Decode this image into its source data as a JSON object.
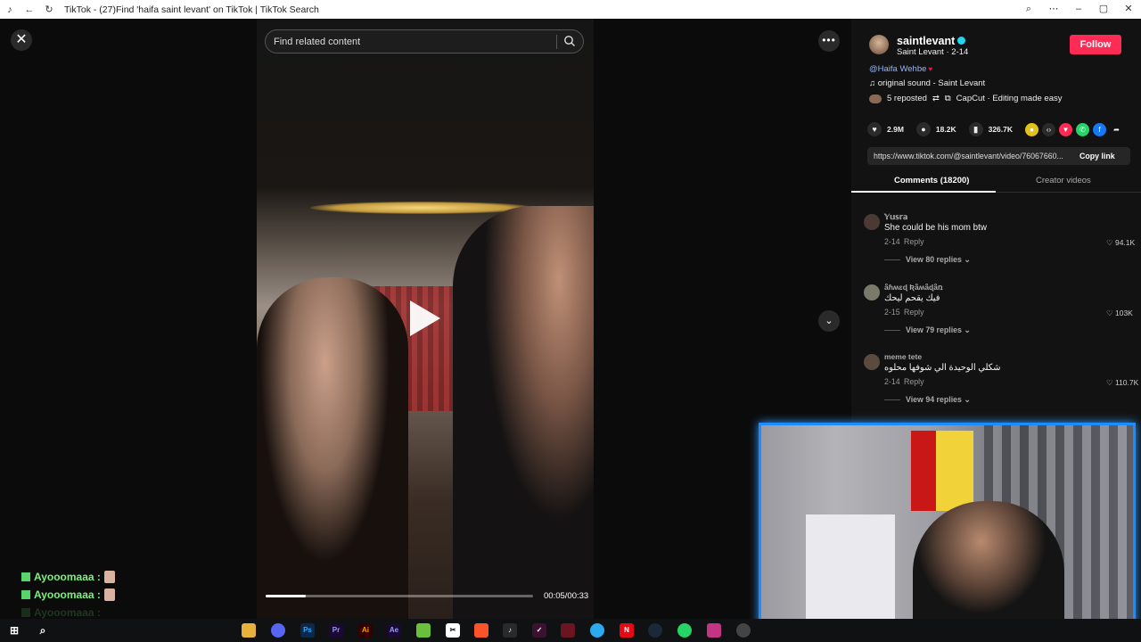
{
  "browser": {
    "title": "TikTok - (27)Find 'haifa saint levant' on TikTok | TikTok Search"
  },
  "search": {
    "placeholder": "Find related content"
  },
  "video": {
    "time": "00:05/00:33",
    "progress_fraction": 0.15
  },
  "author": {
    "username": "saintlevant",
    "subtitle": "Saint Levant · 2-14",
    "follow_label": "Follow",
    "mention": "@Haifa Wehbe",
    "sound": "original sound - Saint Levant",
    "reposted": "5 reposted",
    "capcut": "CapCut · Editing made easy"
  },
  "stats": {
    "likes": "2.9M",
    "comments": "18.2K",
    "saves": "326.7K"
  },
  "share": {
    "url": "https://www.tiktok.com/@saintlevant/video/76067660...",
    "copy_label": "Copy link"
  },
  "tabs": {
    "comments": "Comments (18200)",
    "creator": "Creator videos"
  },
  "comments": [
    {
      "user": "𝕐𝕦𝕤𝕣𝕒",
      "text": "She could be his mom btw",
      "date": "2-14",
      "reply": "Reply",
      "likes": "94.1K",
      "view": "View 80 replies"
    },
    {
      "user": "ǟɦʍɛɖ Ʀǟʍǟɖǟռ",
      "text": "فيك يقحم ليحك",
      "date": "2-15",
      "reply": "Reply",
      "likes": "103K",
      "view": "View 79 replies"
    },
    {
      "user": "meme tete",
      "text": "شكلي الوحيدة الي شوفها محلوه",
      "date": "2-14",
      "reply": "Reply",
      "likes": "110.7K",
      "view": "View 94 replies"
    }
  ],
  "chat": [
    {
      "user": "Ayooomaaa :"
    },
    {
      "user": "Ayooomaaa :"
    },
    {
      "user": "Ayooomaaa :"
    }
  ],
  "colors": {
    "accent": "#fe2c55",
    "verified": "#20d5ec",
    "cam_border": "#1e8bff"
  }
}
